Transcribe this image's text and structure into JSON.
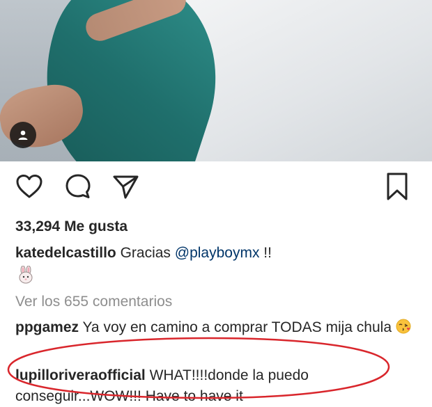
{
  "post": {
    "image_alt": "",
    "tag_icon": "person-tag-icon"
  },
  "actions": {
    "like_icon": "heart-icon",
    "comment_icon": "comment-bubble-icon",
    "share_icon": "paper-plane-icon",
    "save_icon": "bookmark-icon"
  },
  "likes": {
    "text": "33,294 Me gusta"
  },
  "caption": {
    "username": "katedelcastillo",
    "text_before": "Gracias ",
    "mention": "@playboymx",
    "text_after": " !!",
    "emoji_icon": "bunny-emoji-icon"
  },
  "view_comments": {
    "text": "Ver los 655 comentarios"
  },
  "comments": [
    {
      "username": "ppgamez",
      "text": "Ya voy en camino a comprar TODAS mija chula",
      "emoji_icon": "kissing-face-emoji-icon"
    },
    {
      "username": "lupilloriveraofficial",
      "text": "WHAT!!!!donde la puedo conseguir...WOW!!! Have to have it"
    }
  ],
  "colors": {
    "text": "#262626",
    "muted": "#8e8e8e",
    "mention": "#003569",
    "annotation_red": "#d9262c"
  }
}
